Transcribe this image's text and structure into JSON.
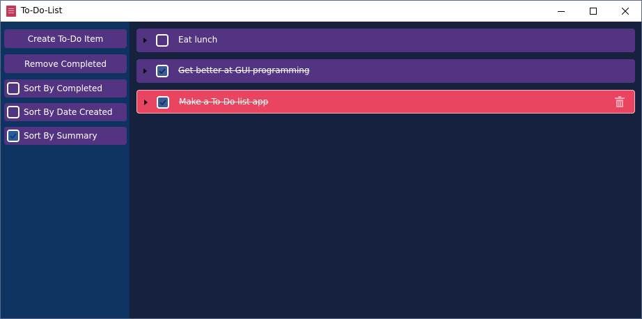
{
  "window": {
    "title": "To-Do-List"
  },
  "sidebar": {
    "create_label": "Create To-Do Item",
    "remove_label": "Remove Completed",
    "sort_options": [
      {
        "label": "Sort By Completed",
        "checked": false
      },
      {
        "label": "Sort By Date Created",
        "checked": false
      },
      {
        "label": "Sort By Summary",
        "checked": true
      }
    ]
  },
  "todos": [
    {
      "summary": "Eat lunch",
      "completed": false
    },
    {
      "summary": "Get better at GUI programming",
      "completed": true
    },
    {
      "summary": "Make a To-Do list app",
      "completed": true,
      "selected": true
    }
  ],
  "colors": {
    "sidebar_bg": "#0e3360",
    "main_bg": "#16213e",
    "item_bg": "#533483",
    "selected_item_bg": "#e94560",
    "app_icon": "#c2385a"
  }
}
